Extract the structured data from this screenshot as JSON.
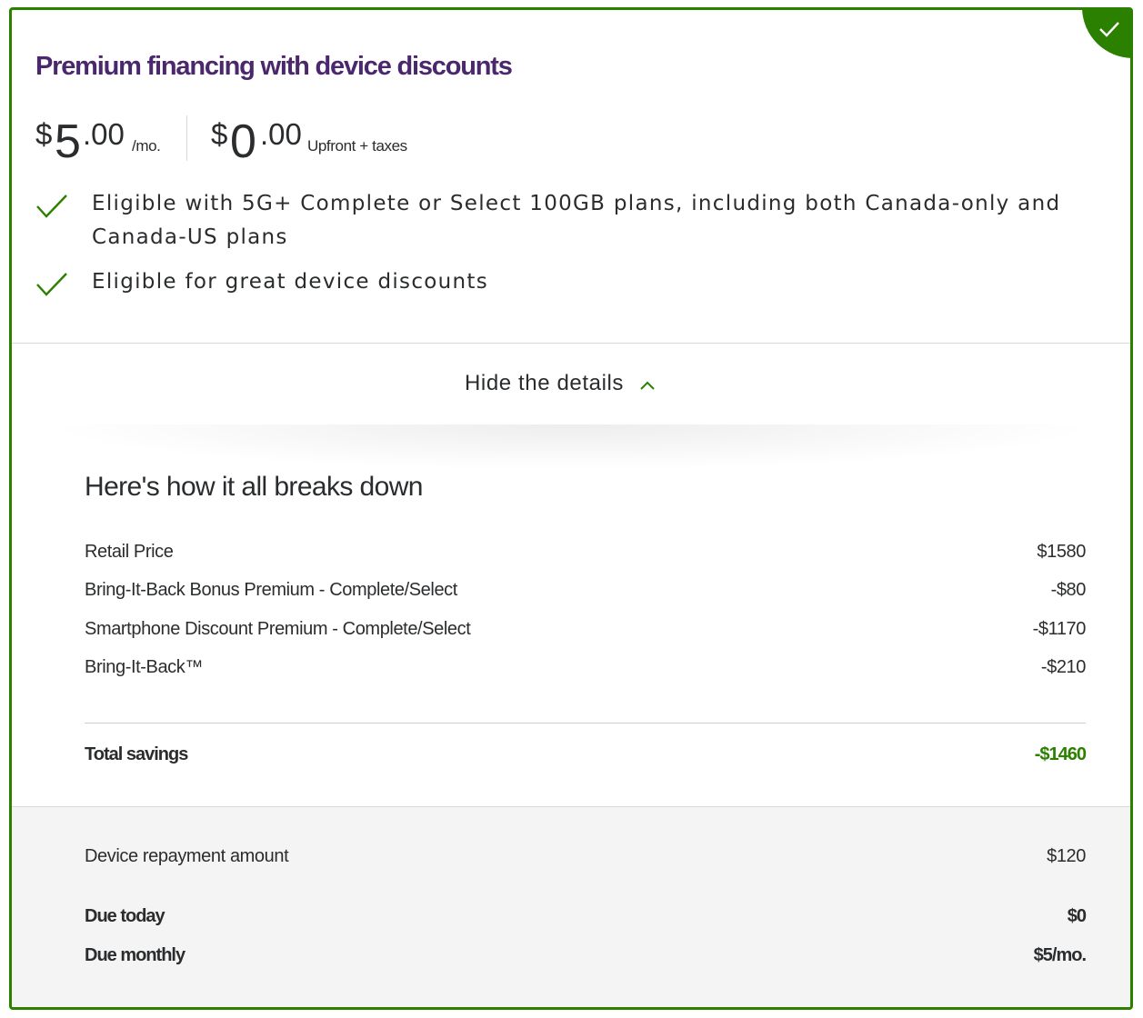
{
  "offer": {
    "title": "Premium financing with device discounts",
    "selected": true,
    "monthly": {
      "currency": "$",
      "dollars": "5",
      "cents": ".00",
      "unit": "/mo."
    },
    "upfront": {
      "currency": "$",
      "dollars": "0",
      "cents": ".00",
      "unit": "Upfront + taxes"
    },
    "features": [
      "Eligible with 5G+ Complete or Select 100GB plans, including both Canada-only and Canada-US plans",
      "Eligible for great device discounts"
    ]
  },
  "details": {
    "toggle_label": "Hide the details"
  },
  "breakdown": {
    "title": "Here's how it all breaks down",
    "items": [
      {
        "label": "Retail Price",
        "value": "$1580"
      },
      {
        "label": "Bring-It-Back Bonus Premium - Complete/Select",
        "value": "-$80"
      },
      {
        "label": "Smartphone Discount Premium - Complete/Select",
        "value": "-$1170"
      },
      {
        "label": "Bring-It-Back™",
        "value": "-$210"
      }
    ],
    "total": {
      "label": "Total savings",
      "value": "-$1460"
    }
  },
  "summary": {
    "repayment": {
      "label": "Device repayment amount",
      "value": "$120"
    },
    "due_today": {
      "label": "Due today",
      "value": "$0"
    },
    "due_monthly": {
      "label": "Due monthly",
      "value": "$5/mo."
    }
  },
  "colors": {
    "brand_purple": "#4b286d",
    "accent_green": "#2b8000"
  },
  "icons": {
    "selected": "check-icon",
    "feature": "check-icon",
    "toggle": "chevron-up-icon"
  }
}
